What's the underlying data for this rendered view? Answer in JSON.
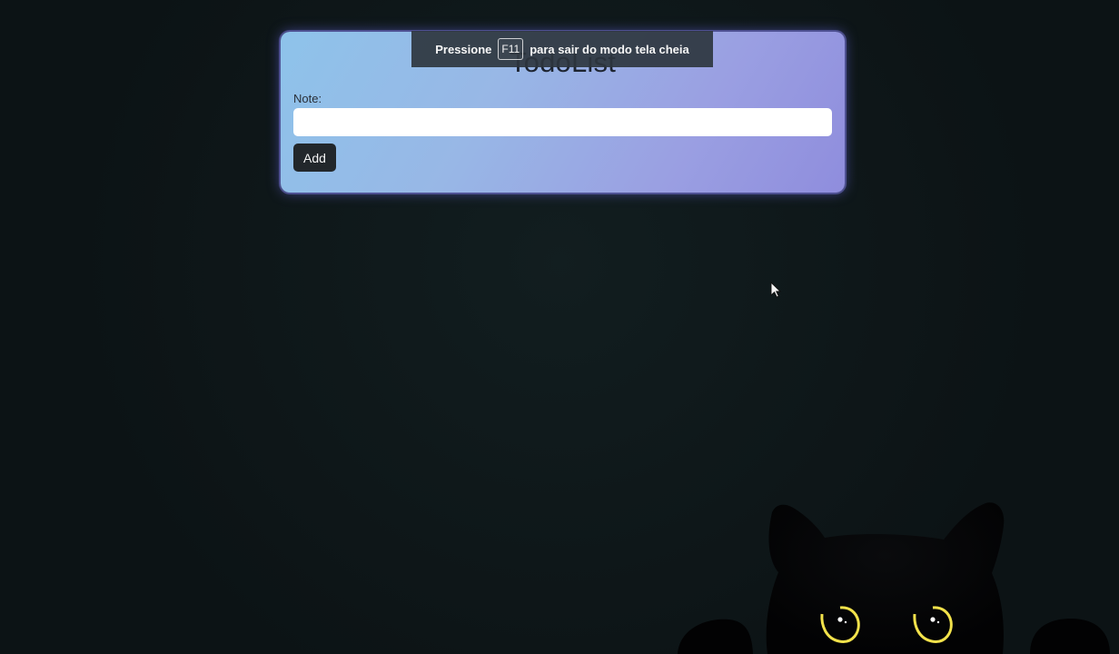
{
  "app": {
    "title": "TodoList"
  },
  "form": {
    "note_label": "Note:",
    "note_input_value": "",
    "note_input_placeholder": "",
    "add_button_label": "Add"
  },
  "fullscreen_notice": {
    "prefix": "Pressione",
    "key": "F11",
    "suffix": "para sair do modo tela cheia"
  },
  "colors": {
    "page_background": "#0f1719",
    "card_gradient_start": "#8ec3ea",
    "card_gradient_end": "#8f8ddd",
    "button_background": "#22272b",
    "banner_background": "#2e363f",
    "cat_eye": "#f2e24b"
  },
  "icons": {
    "cursor": "mouse-pointer-icon",
    "cat": "cat-peeking-icon"
  }
}
